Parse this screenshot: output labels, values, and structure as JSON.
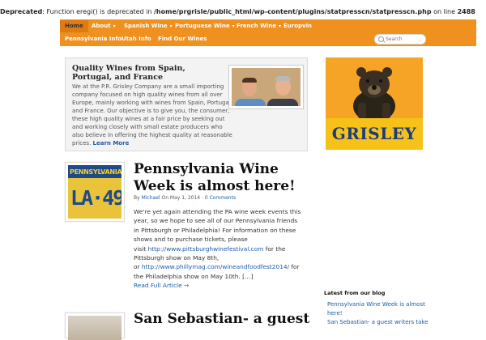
{
  "notice": {
    "label": "Deprecated",
    "message": ": Function eregi() is deprecated in ",
    "path": "/home/prgrisle/public_html/wp-content/plugins/statpresscn/statpresscn.php",
    "on_line": " on line ",
    "line": "2488"
  },
  "nav": {
    "items": [
      {
        "label": "Home"
      },
      {
        "label": "About"
      },
      {
        "label": "Spanish Wine"
      },
      {
        "label": "Portuguese Wine"
      },
      {
        "label": "French Wine"
      },
      {
        "label": "Europvin"
      },
      {
        "label": "Pennsylvania Info"
      },
      {
        "label": "Utah Info"
      },
      {
        "label": "Find Our Wines"
      }
    ],
    "search_placeholder": "Search"
  },
  "intro": {
    "title": "Quality Wines from Spain, Portugal, and France",
    "text": "We at the P.R. Grisley Company are a small importing company focused on high quality wines from all over Europe, mainly working with wines from Spain, Portugal and France. Our objective is to give you, the consumer, these high quality wines at a fair price by seeking out and working closely with small estate producers who also believe in offering the highest quality at reasonable prices. ",
    "link": "Learn More"
  },
  "posts": [
    {
      "title": "Pennsylvania Wine Week is almost here!",
      "plate_state": "PENNSYLVANIA",
      "plate_number": "LA·49",
      "meta_by": "By ",
      "author": "Michael",
      "meta_on": " On May 1, 2014 · ",
      "comments": "0 Comments",
      "p1": "We're yet again attending the PA wine week events this year, so we hope to see all of our Pennsylvania friends in Pittsburgh or Philadelphia! For information on these shows and to purchase tickets, please",
      "visit": "visit ",
      "link1": "http://www.pittsburghwinefestival.com",
      "after1": " for the Pittsburgh show on May 8th,",
      "or": "or ",
      "link2": "http://www.phillymag.com/wineandfoodfest2014/",
      "after2": " for the Philadelphia show on May 10th. […]",
      "read_more": "Read Full Article →"
    },
    {
      "title": "San Sebastian- a guest"
    }
  ],
  "sidebar": {
    "logo_text": "GRISLEY",
    "blog_heading": "Latest from our blog",
    "blog_links": [
      "Pennsylvania Wine Week is almost here!",
      "San Sebastian- a guest writers take"
    ]
  },
  "colors": {
    "nav_bg": "#f0901f",
    "link": "#1a5da6",
    "logo_orange": "#f6a425",
    "logo_blue": "#1b3c7d"
  }
}
